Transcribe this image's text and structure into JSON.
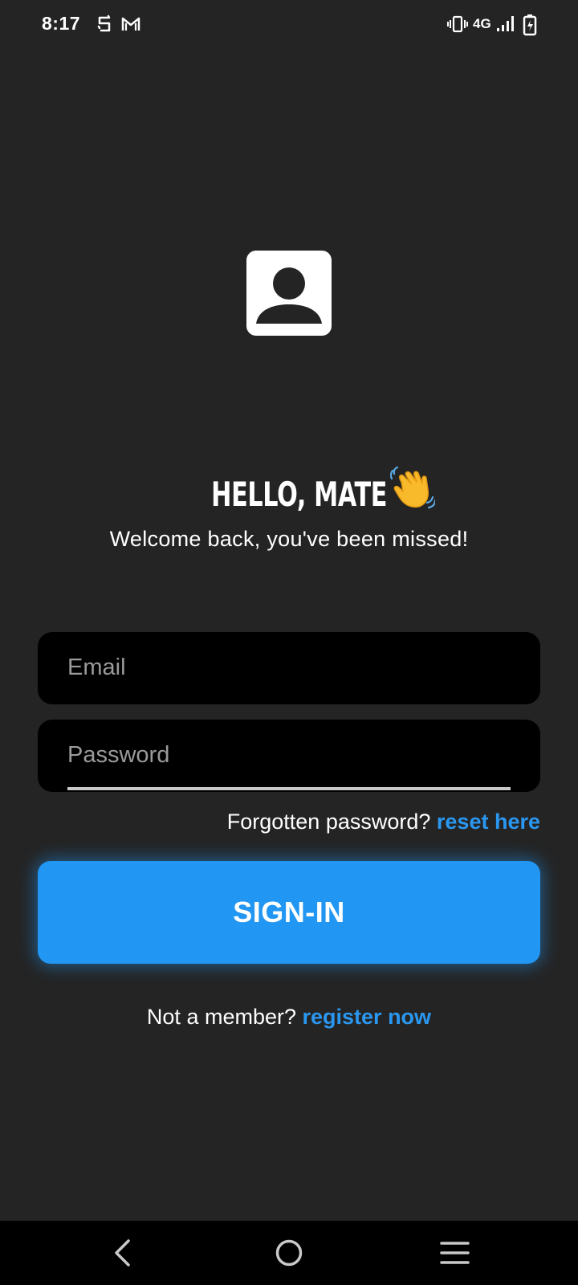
{
  "status_bar": {
    "time": "8:17",
    "left_icons": [
      "vpn-icon",
      "gmail-icon"
    ],
    "network_label": "4G",
    "right_icons": [
      "vibrate-icon",
      "signal-icon",
      "battery-charging-icon"
    ]
  },
  "login": {
    "avatar_icon": "person-icon",
    "headline": "HELLO, MATE",
    "headline_emoji": "waving-hand-icon",
    "subtitle": "Welcome back, you've been missed!",
    "email_placeholder": "Email",
    "email_value": "",
    "password_placeholder": "Password",
    "password_value": "",
    "forgot_prompt": "Forgotten password?",
    "forgot_link": "reset here",
    "signin_label": "SIGN-IN",
    "register_prompt": "Not a member?",
    "register_link": "register now"
  },
  "nav_bar": {
    "icons": [
      "back-icon",
      "home-icon",
      "recents-menu-icon"
    ]
  },
  "colors": {
    "background": "#242424",
    "input_background": "#000000",
    "accent": "#2196f3",
    "link": "#2a97f0",
    "nav_background": "#000000"
  }
}
